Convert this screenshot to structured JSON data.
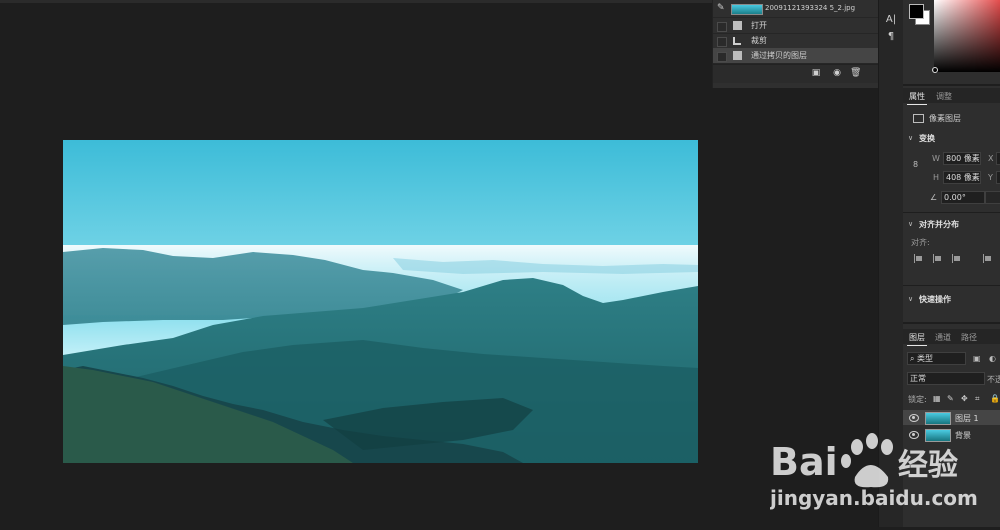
{
  "history": {
    "snapshot": "20091121393324 5_2.jpg",
    "items": [
      {
        "label": "打开",
        "icon": "document-icon"
      },
      {
        "label": "裁剪",
        "icon": "crop-icon"
      },
      {
        "label": "通过拷贝的图层",
        "icon": "document-icon"
      }
    ]
  },
  "properties": {
    "tabs": [
      "属性",
      "调整"
    ],
    "layer_type": "像素图层",
    "transform": {
      "title": "变换",
      "w_label": "W",
      "w_value": "800 像素",
      "x_label": "X",
      "h_label": "H",
      "h_value": "408 像素",
      "y_label": "Y",
      "angle_value": "0.00°"
    },
    "align": {
      "title": "对齐并分布",
      "label": "对齐:"
    },
    "quick": {
      "title": "快速操作"
    }
  },
  "layers": {
    "tabs": [
      "图层",
      "通道",
      "路径"
    ],
    "filter_label": "类型",
    "blend_mode": "正常",
    "opacity_label": "不透",
    "lock_label": "锁定:",
    "items": [
      {
        "name": "图层 1",
        "selected": true
      },
      {
        "name": "背景",
        "selected": false
      }
    ]
  },
  "watermark": {
    "brand": "Bai",
    "brand2": "经验",
    "url": "jingyan.baidu.com"
  },
  "colors": {
    "fg": "#000000",
    "bg": "#ffffff",
    "workspace": "#1e1e1e",
    "panel": "#2e2e2e"
  }
}
